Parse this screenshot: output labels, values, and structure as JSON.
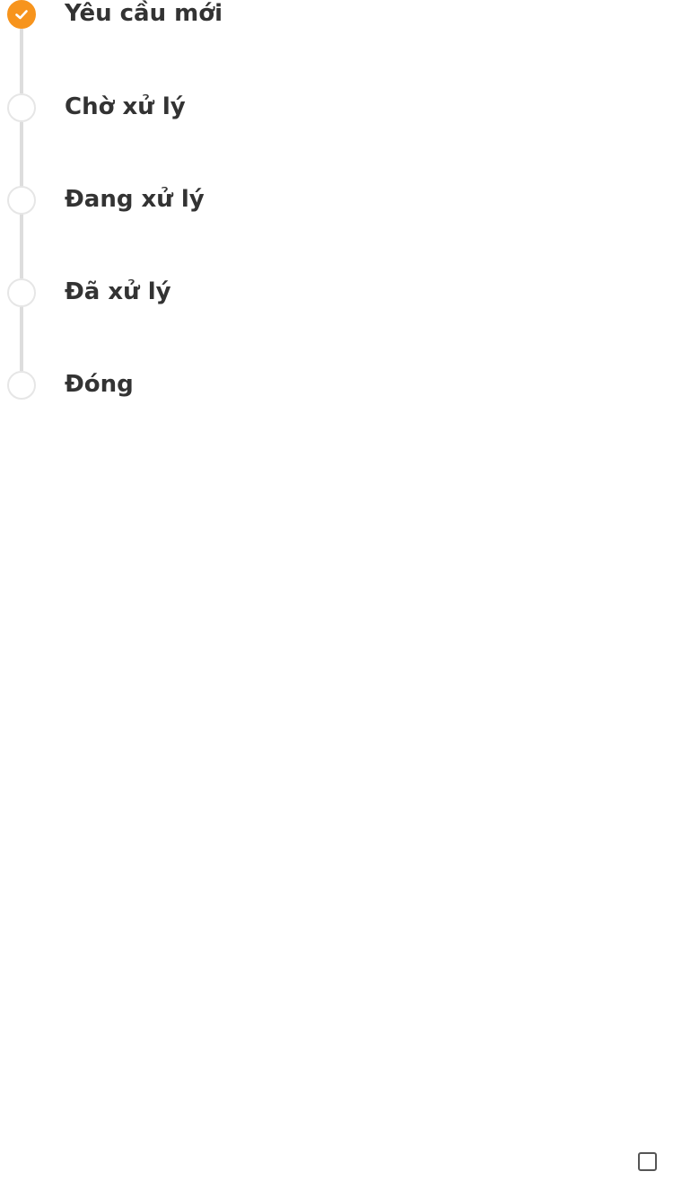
{
  "timeline": {
    "accent_color": "#f7941d",
    "steps": [
      {
        "label": "Yêu cầu mới",
        "status": "done",
        "icon": "check-icon"
      },
      {
        "label": "Chờ xử lý",
        "status": "pending"
      },
      {
        "label": "Đang xử lý",
        "status": "pending"
      },
      {
        "label": "Đã xử lý",
        "status": "pending"
      },
      {
        "label": "Đóng",
        "status": "pending"
      }
    ]
  }
}
